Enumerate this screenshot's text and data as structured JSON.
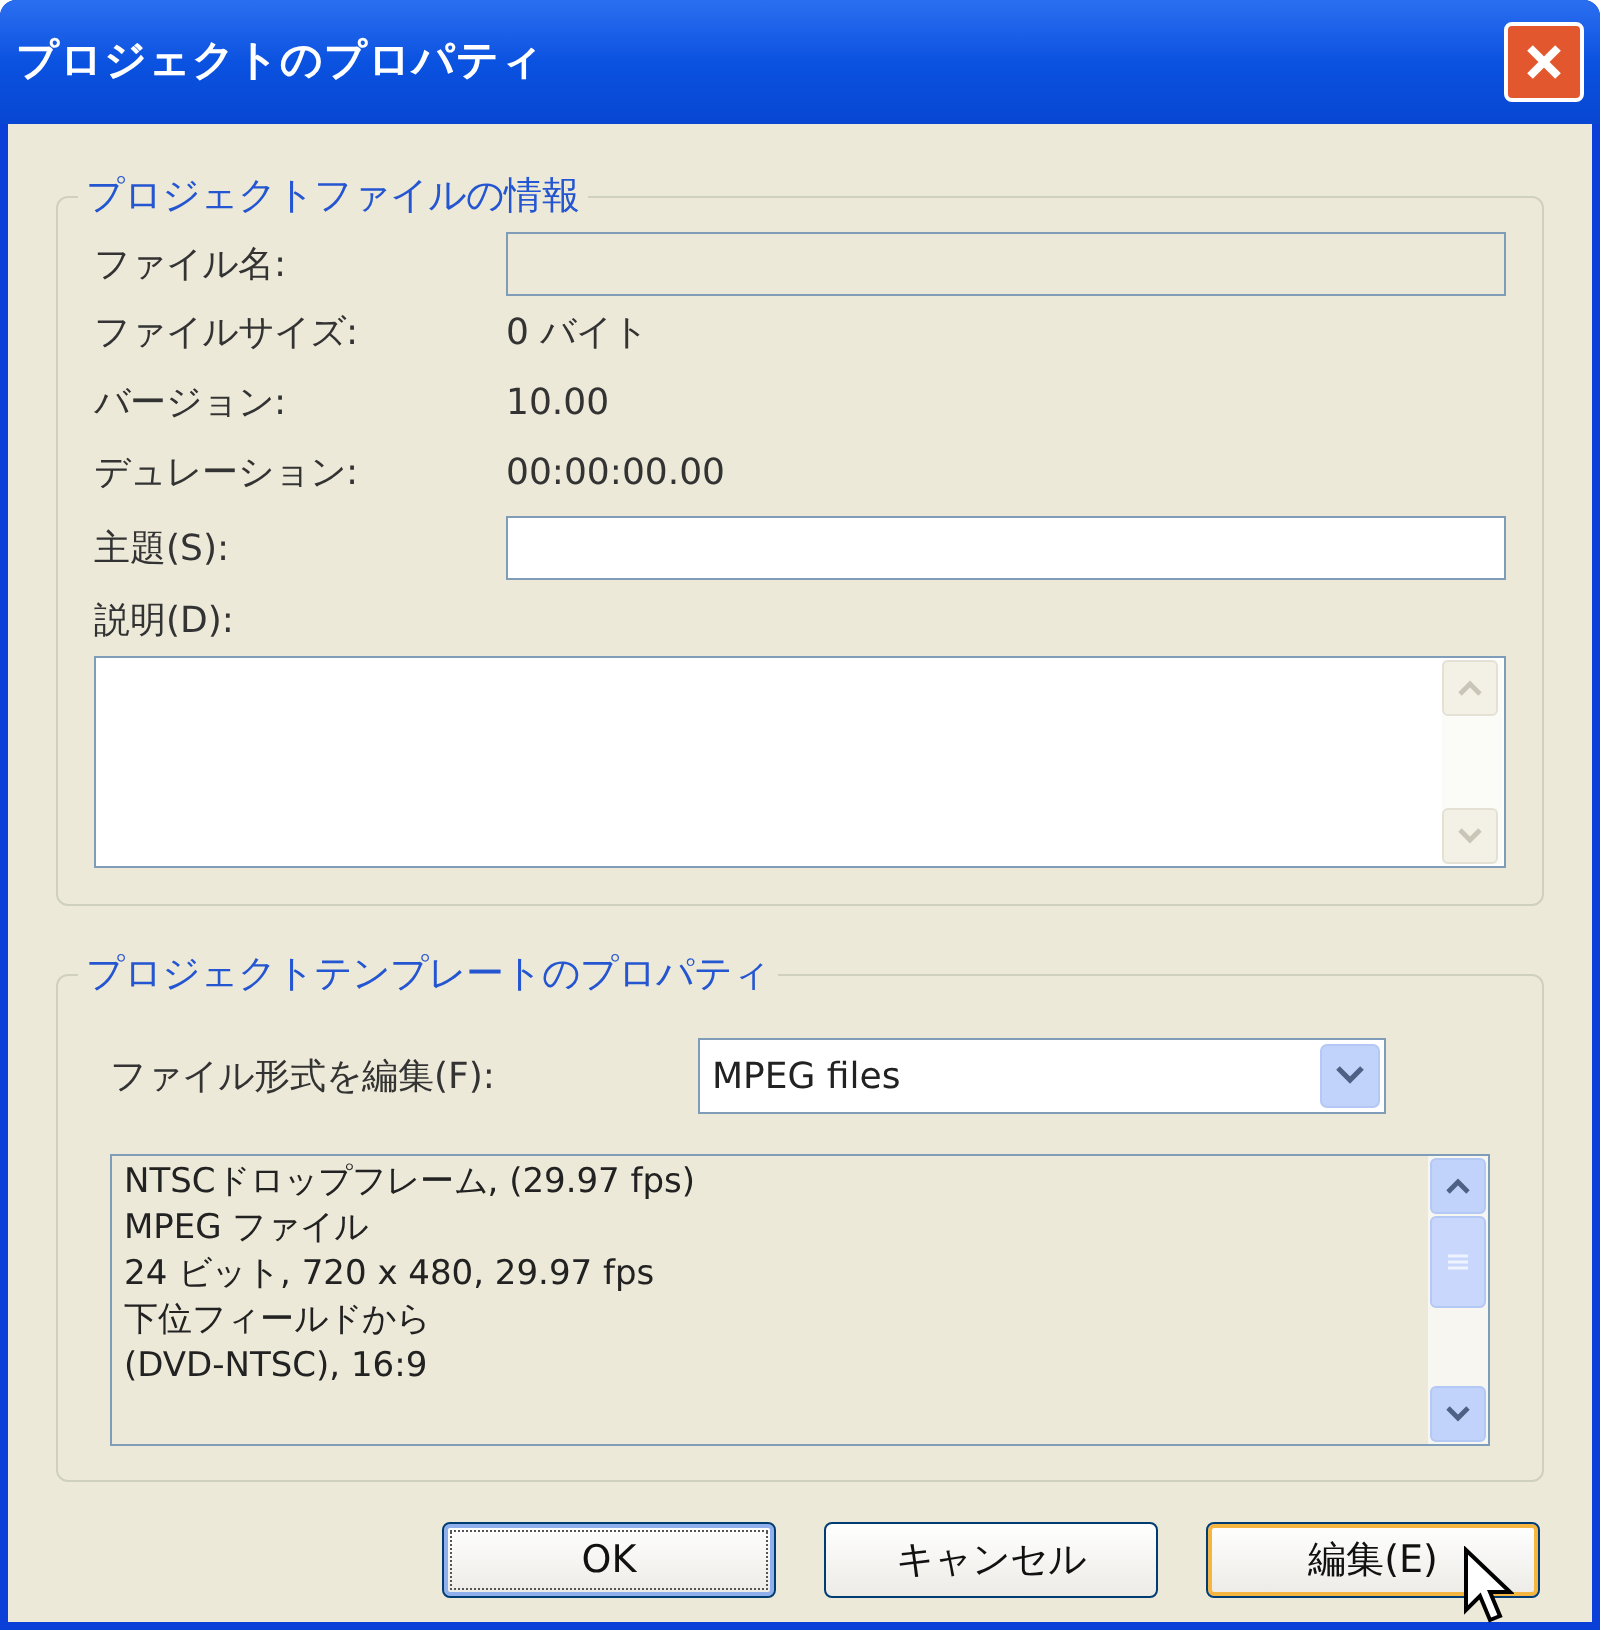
{
  "window": {
    "title": "プロジェクトのプロパティ"
  },
  "file_info": {
    "legend": "プロジェクトファイルの情報",
    "file_name": {
      "label": "ファイル名:",
      "disabled": true
    },
    "rows": [
      {
        "label": "ファイルサイズ:",
        "value": "0 バイト"
      },
      {
        "label": "バージョン:",
        "value": "10.00"
      },
      {
        "label": "デュレーション:",
        "value": "00:00:00.00"
      }
    ],
    "subject": {
      "label": "主題(S):",
      "disabled": false
    },
    "description": {
      "label": "説明(D):"
    }
  },
  "template": {
    "legend": "プロジェクトテンプレートのプロパティ",
    "format_label": "ファイル形式を編集(F):",
    "format_value": "MPEG files",
    "details": [
      "NTSCドロップフレーム, (29.97 fps)",
      "MPEG ファイル",
      "24 ビット, 720 x 480, 29.97 fps",
      "下位フィールドから",
      "(DVD-NTSC), 16:9"
    ]
  },
  "buttons": [
    {
      "label": "OK",
      "default": true,
      "hovered": false
    },
    {
      "label": "キャンセル",
      "default": false,
      "hovered": false
    },
    {
      "label": "編集(E)",
      "default": false,
      "hovered": true
    }
  ]
}
